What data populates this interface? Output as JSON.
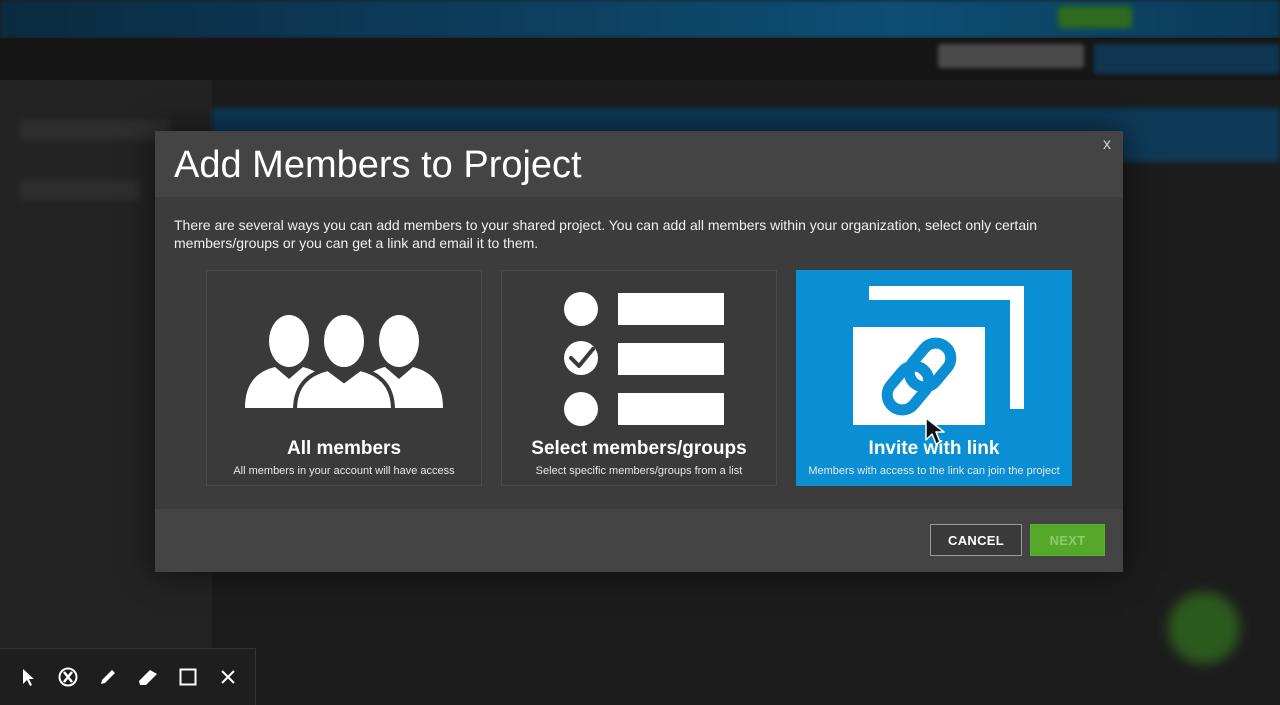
{
  "modal": {
    "title": "Add Members to Project",
    "close_label": "x",
    "description": "There are several ways you can add members to your shared project. You can add all members within your organization, select only certain members/groups or you can get a link and email it to them.",
    "options": [
      {
        "title": "All members",
        "subtitle": "All members in your account will have access",
        "icon": "people-group-icon",
        "selected": false
      },
      {
        "title": "Select members/groups",
        "subtitle": "Select specific members/groups from a list",
        "icon": "checklist-icon",
        "selected": false
      },
      {
        "title": "Invite with link",
        "subtitle": "Members with access to the link can join the project",
        "icon": "link-icon",
        "selected": true
      }
    ],
    "buttons": {
      "cancel": "CANCEL",
      "next": "NEXT"
    }
  },
  "annotation_toolbar": {
    "tools": [
      "pointer-icon",
      "highlighter-icon",
      "pen-icon",
      "eraser-icon",
      "rectangle-icon",
      "close-icon"
    ]
  },
  "colors": {
    "accent_blue": "#0a8fd4",
    "next_green": "#56a82b",
    "modal_bg": "#3c3c3c"
  }
}
